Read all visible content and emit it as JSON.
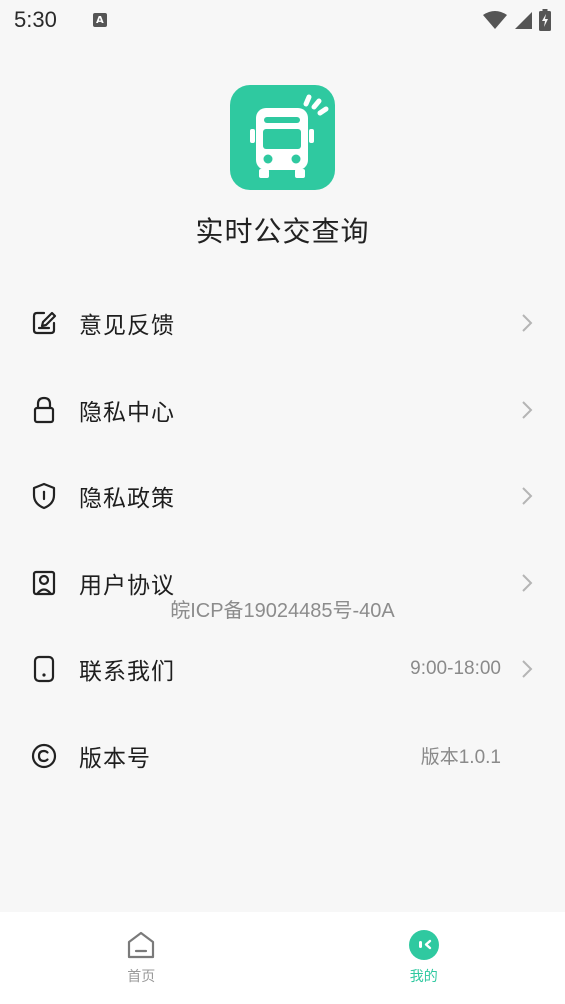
{
  "status_bar": {
    "time": "5:30",
    "notification_icon_text": "A"
  },
  "app": {
    "name": "实时公交查询",
    "logo_color": "#2fc9a0"
  },
  "menu": [
    {
      "label": "意见反馈",
      "value": "",
      "icon": "feedback-icon",
      "chevron": true
    },
    {
      "label": "隐私中心",
      "value": "",
      "icon": "lock-icon",
      "chevron": true
    },
    {
      "label": "隐私政策",
      "value": "",
      "icon": "shield-icon",
      "chevron": true
    },
    {
      "label": "用户协议",
      "value": "",
      "icon": "user-card-icon",
      "chevron": true
    },
    {
      "label": "联系我们",
      "value": "9:00-18:00",
      "icon": "phone-icon",
      "chevron": true
    },
    {
      "label": "版本号",
      "value": "版本1.0.1",
      "icon": "copyright-icon",
      "chevron": false
    }
  ],
  "icp": "皖ICP备19024485号-40A",
  "tabbar": {
    "home_label": "首页",
    "mine_label": "我的",
    "active": "mine",
    "accent": "#2fc9a0"
  }
}
